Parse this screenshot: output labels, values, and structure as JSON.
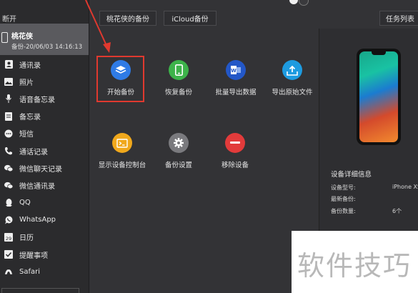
{
  "sidebar": {
    "disconnect": "断开",
    "device": {
      "name": "桃花侠",
      "subtitle": "备份-20/06/03 14:16:13"
    },
    "items": [
      {
        "label": "通讯录",
        "icon": "contacts-icon"
      },
      {
        "label": "照片",
        "icon": "photos-icon"
      },
      {
        "label": "语音备忘录",
        "icon": "microphone-icon"
      },
      {
        "label": "备忘录",
        "icon": "notes-icon"
      },
      {
        "label": "短信",
        "icon": "message-icon"
      },
      {
        "label": "通话记录",
        "icon": "phone-call-icon"
      },
      {
        "label": "微信聊天记录",
        "icon": "wechat-icon"
      },
      {
        "label": "微信通讯录",
        "icon": "wechat-contacts-icon"
      },
      {
        "label": "QQ",
        "icon": "qq-icon"
      },
      {
        "label": "WhatsApp",
        "icon": "whatsapp-icon"
      },
      {
        "label": "日历",
        "icon": "calendar-icon"
      },
      {
        "label": "提醒事项",
        "icon": "reminders-icon"
      },
      {
        "label": "Safari",
        "icon": "safari-icon"
      }
    ]
  },
  "topbar": {
    "tab_backup": "桃花侠的备份",
    "tab_icloud": "iCloud备份",
    "task_list": "任务列表"
  },
  "tools": [
    {
      "label": "开始备份",
      "icon": "layers-icon",
      "color": "#2f7be6"
    },
    {
      "label": "恢复备份",
      "icon": "phone-restore-icon",
      "color": "#3db34a"
    },
    {
      "label": "批量导出数据",
      "icon": "word-export-icon",
      "color": "#2357c7"
    },
    {
      "label": "导出原始文件",
      "icon": "upload-icon",
      "color": "#1e9be0"
    },
    {
      "label": "显示设备控制台",
      "icon": "console-icon",
      "color": "#f0a81c"
    },
    {
      "label": "备份设置",
      "icon": "gear-icon",
      "color": "#7a7a7e"
    },
    {
      "label": "移除设备",
      "icon": "minus-icon",
      "color": "#e23b3b"
    }
  ],
  "device_info": {
    "title": "设备详细信息",
    "model_label": "设备型号:",
    "model_value": "iPhone XS",
    "latest_label": "最新备份:",
    "latest_value": "",
    "count_label": "备份数量:",
    "count_value": "6个"
  },
  "watermark": "软件技巧"
}
